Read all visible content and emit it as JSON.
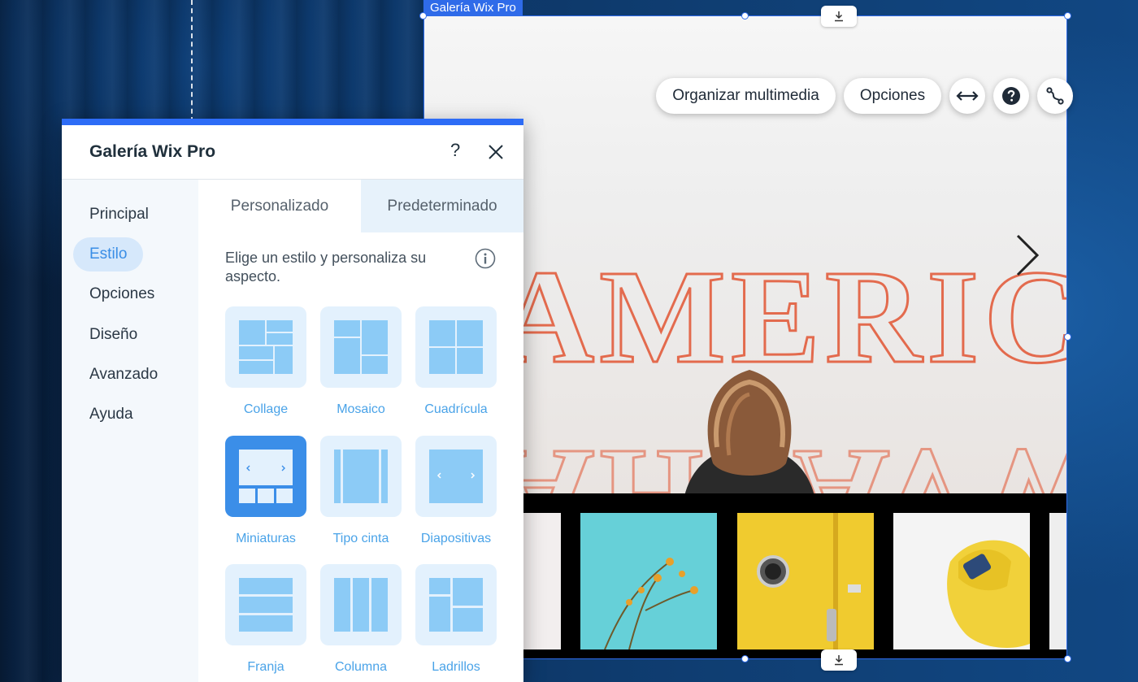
{
  "gallery": {
    "label": "Galería Wix Pro",
    "toolbar": {
      "organize_label": "Organizar multimedia",
      "options_label": "Opciones",
      "stretch_icon": "stretch-arrows-icon",
      "help_icon": "help-circle-icon",
      "connect_icon": "connect-path-icon"
    },
    "hero_sign_text": "AMERICA"
  },
  "panel": {
    "title": "Galería Wix Pro",
    "help_label": "?",
    "nav": [
      {
        "label": "Principal"
      },
      {
        "label": "Estilo"
      },
      {
        "label": "Opciones"
      },
      {
        "label": "Diseño"
      },
      {
        "label": "Avanzado"
      },
      {
        "label": "Ayuda"
      }
    ],
    "active_nav": "Estilo",
    "tabs": [
      {
        "label": "Personalizado"
      },
      {
        "label": "Predeterminado"
      }
    ],
    "description": "Elige un estilo y personaliza su aspecto.",
    "styles": [
      {
        "label": "Collage"
      },
      {
        "label": "Mosaico"
      },
      {
        "label": "Cuadrícula"
      },
      {
        "label": "Miniaturas"
      },
      {
        "label": "Tipo cinta"
      },
      {
        "label": "Diapositivas"
      },
      {
        "label": "Franja"
      },
      {
        "label": "Columna"
      },
      {
        "label": "Ladrillos"
      }
    ],
    "selected_style": "Miniaturas"
  },
  "colors": {
    "selection_blue": "#2f6be9",
    "accent": "#3b8ee8",
    "tile_bg": "#e3f1fd",
    "tile_icon": "#8ccbf6"
  }
}
